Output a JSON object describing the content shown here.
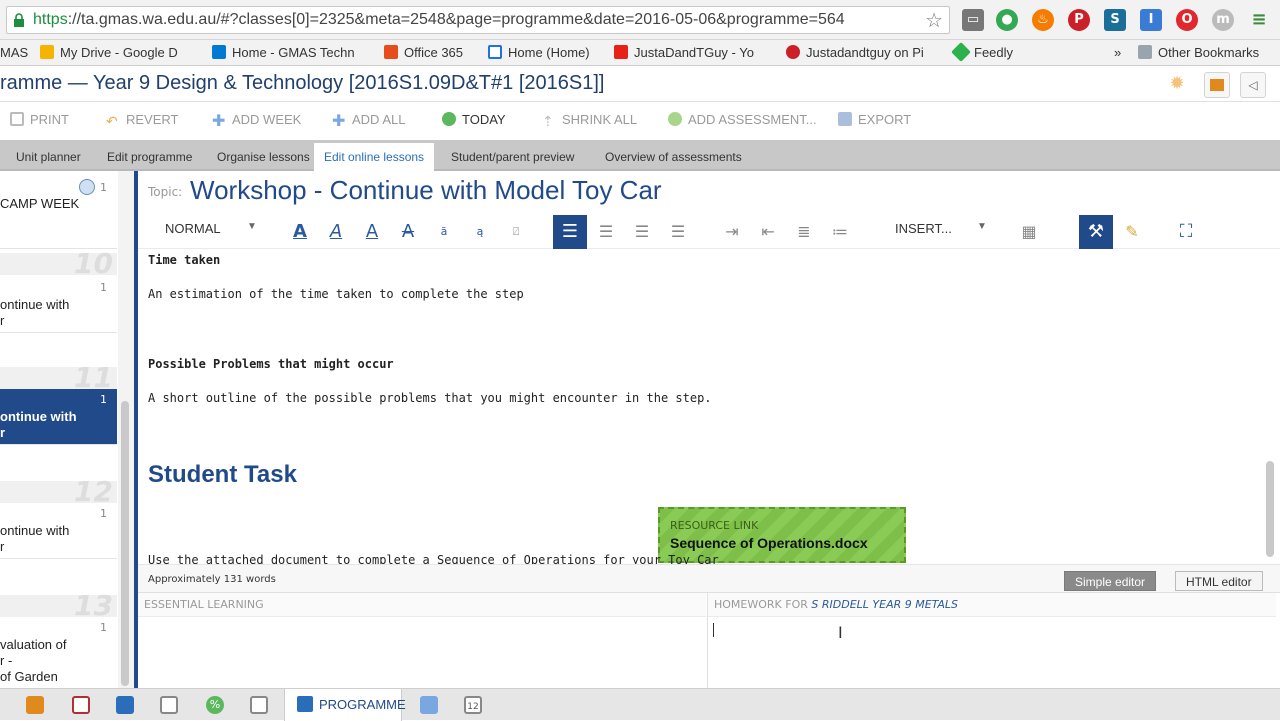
{
  "browser": {
    "url_scheme": "https",
    "url_rest": "://ta.gmas.wa.edu.au/#?classes[0]=2325&meta=2548&page=programme&date=2016-05-06&programme=564",
    "bookmarks": [
      {
        "label": "MAS",
        "icon": "bookmark-icon",
        "color": "#888888"
      },
      {
        "label": "My Drive - Google D",
        "icon": "google-drive-icon",
        "color": "#f4b400"
      },
      {
        "label": "Home - GMAS Techn",
        "icon": "sharepoint-icon",
        "color": "#0078d4"
      },
      {
        "label": "Office 365",
        "icon": "office365-icon",
        "color": "#e74c1c"
      },
      {
        "label": "Home (Home)",
        "icon": "page-icon",
        "color": "#1a73e8"
      },
      {
        "label": "JustaDandTGuy - Yo",
        "icon": "youtube-icon",
        "color": "#e62117"
      },
      {
        "label": "Justadandtguy on Pi",
        "icon": "pinterest-icon",
        "color": "#cb2027"
      },
      {
        "label": "Feedly",
        "icon": "feedly-icon",
        "color": "#2bb24c"
      }
    ],
    "more": "»",
    "other_bookmarks": "Other Bookmarks"
  },
  "page": {
    "title": "ramme — Year 9 Design & Technology [2016S1.09D&T#1 [2016S1]]"
  },
  "toolbar": {
    "items": [
      {
        "label": "PRINT",
        "icon": "print-icon"
      },
      {
        "label": "REVERT",
        "icon": "revert-icon"
      },
      {
        "label": "ADD WEEK",
        "icon": "add-week-icon"
      },
      {
        "label": "ADD ALL",
        "icon": "add-all-icon"
      },
      {
        "label": "TODAY",
        "icon": "today-icon"
      },
      {
        "label": "SHRINK ALL",
        "icon": "shrink-icon"
      },
      {
        "label": "ADD ASSESSMENT...",
        "icon": "add-assessment-icon"
      },
      {
        "label": "EXPORT",
        "icon": "export-icon"
      }
    ]
  },
  "tabs": [
    "Unit planner",
    "Edit programme",
    "Organise lessons",
    "Edit online lessons",
    "Student/parent preview",
    "Overview of assessments"
  ],
  "active_tab": "Edit online lessons",
  "sidebar": {
    "lessons": [
      {
        "text": "CAMP WEEK",
        "num": "1"
      },
      {
        "text": "ontinue with\nr",
        "num": "1"
      },
      {
        "text": "ontinue with\nr",
        "num": "1",
        "selected": true
      },
      {
        "text": "ontinue with\nr",
        "num": "1"
      },
      {
        "text": "valuation of\nr -\nof Garden",
        "num": "1"
      }
    ],
    "weeks": [
      "10",
      "11",
      "12",
      "13"
    ]
  },
  "editor": {
    "topic_label": "Topic:",
    "topic": "Workshop - Continue with Model Toy Car",
    "style_select": "NORMAL",
    "insert_menu": "INSERT...",
    "content": {
      "time_heading": "Time taken",
      "time_text": "An estimation of the time taken to complete the step",
      "problems_heading": "Possible Problems that might occur",
      "problems_text": "A short outline of the possible problems that you might encounter in the step.",
      "task_heading": "Student Task",
      "task_text": "Use the attached document to complete a Sequence of Operations for your Toy Car"
    },
    "resource": {
      "kind": "RESOURCE LINK",
      "name": "Sequence of Operations.docx"
    },
    "word_count": "Approximately 131 words",
    "modes": [
      "Simple editor",
      "HTML editor"
    ],
    "essential_learning": "ESSENTIAL LEARNING",
    "homework_prefix": "HOMEWORK FOR",
    "homework_group": "S RIDDELL YEAR 9 METALS"
  },
  "bottom": {
    "active_label": "PROGRAMME",
    "icons": [
      {
        "name": "folder-icon",
        "color": "#e08a1e"
      },
      {
        "name": "book-icon",
        "color": "#b03030"
      },
      {
        "name": "document-icon",
        "color": "#2a6ebb"
      },
      {
        "name": "chat-icon",
        "color": "#888888"
      },
      {
        "name": "percent-icon",
        "color": "#5cb85c"
      },
      {
        "name": "list-icon",
        "color": "#888888"
      },
      {
        "name": "clipboard-icon",
        "color": "#2a6ebb"
      },
      {
        "name": "calendar-icon",
        "color": "#888888"
      }
    ]
  }
}
